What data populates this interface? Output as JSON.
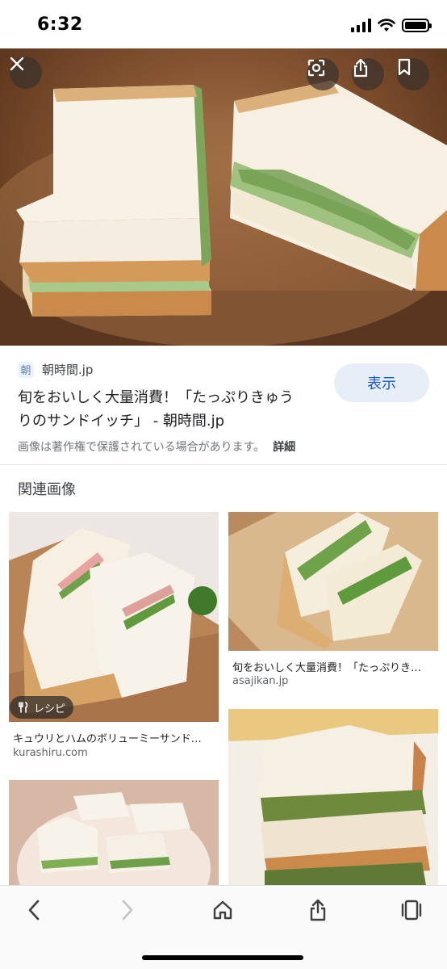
{
  "status": {
    "time": "6:32"
  },
  "hero": {
    "close_icon": "close-icon",
    "lens_icon": "lens-icon",
    "share_icon": "share-icon",
    "bookmark_icon": "bookmark-icon"
  },
  "source": {
    "logo_text": "朝",
    "name": "朝時間.jp",
    "visit_label": "表示",
    "title_line1": "旬をおいしく大量消費！「たっぷりきゅう",
    "title_line2": "りのサンドイッチ」 - 朝時間.jp",
    "copyright": "画像は著作権で保護されている場合があります。",
    "details_label": "詳細"
  },
  "related": {
    "heading": "関連画像",
    "items": [
      {
        "caption": "キュウリとハムのボリューミーサンド…",
        "domain": "kurashiru.com",
        "badge": "レシピ"
      },
      {
        "caption": "旬をおいしく大量消費！「たっぷりき…",
        "domain": "asajikan.jp"
      }
    ]
  },
  "toolbar": {
    "back_icon": "back-icon",
    "forward_icon": "forward-icon",
    "home_icon": "home-icon",
    "share_icon": "share-icon",
    "tabs_icon": "tabs-icon"
  }
}
